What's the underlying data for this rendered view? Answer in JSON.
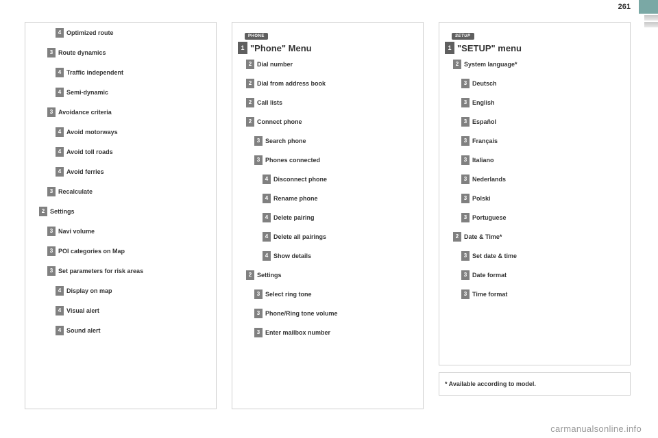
{
  "page_number": "261",
  "footer_url": "carmanualsonline.info",
  "footnote": "* Available according to model.",
  "col1": {
    "items": [
      {
        "n": "4",
        "label": "Optimized route",
        "indent": 3
      },
      {
        "n": "3",
        "label": "Route dynamics",
        "indent": 2
      },
      {
        "n": "4",
        "label": "Traffic independent",
        "indent": 3
      },
      {
        "n": "4",
        "label": "Semi-dynamic",
        "indent": 3
      },
      {
        "n": "3",
        "label": "Avoidance criteria",
        "indent": 2
      },
      {
        "n": "4",
        "label": "Avoid motorways",
        "indent": 3
      },
      {
        "n": "4",
        "label": "Avoid toll roads",
        "indent": 3
      },
      {
        "n": "4",
        "label": "Avoid ferries",
        "indent": 3
      },
      {
        "n": "3",
        "label": "Recalculate",
        "indent": 2
      },
      {
        "n": "2",
        "label": "Settings",
        "indent": 1
      },
      {
        "n": "3",
        "label": "Navi volume",
        "indent": 2
      },
      {
        "n": "3",
        "label": "POI categories on Map",
        "indent": 2
      },
      {
        "n": "3",
        "label": "Set parameters for risk areas",
        "indent": 2
      },
      {
        "n": "4",
        "label": "Display on map",
        "indent": 3
      },
      {
        "n": "4",
        "label": "Visual alert",
        "indent": 3
      },
      {
        "n": "4",
        "label": "Sound alert",
        "indent": 3
      }
    ]
  },
  "col2": {
    "chip": "PHONE",
    "title_num": "1",
    "title": "\"Phone\" Menu",
    "items": [
      {
        "n": "2",
        "label": "Dial number",
        "indent": 1
      },
      {
        "n": "2",
        "label": "Dial from address book",
        "indent": 1
      },
      {
        "n": "2",
        "label": "Call lists",
        "indent": 1
      },
      {
        "n": "2",
        "label": "Connect phone",
        "indent": 1
      },
      {
        "n": "3",
        "label": "Search phone",
        "indent": 2
      },
      {
        "n": "3",
        "label": "Phones connected",
        "indent": 2
      },
      {
        "n": "4",
        "label": "Disconnect phone",
        "indent": 3
      },
      {
        "n": "4",
        "label": "Rename phone",
        "indent": 3
      },
      {
        "n": "4",
        "label": "Delete pairing",
        "indent": 3
      },
      {
        "n": "4",
        "label": "Delete all pairings",
        "indent": 3
      },
      {
        "n": "4",
        "label": "Show details",
        "indent": 3
      },
      {
        "n": "2",
        "label": "Settings",
        "indent": 1
      },
      {
        "n": "3",
        "label": "Select ring tone",
        "indent": 2
      },
      {
        "n": "3",
        "label": "Phone/Ring tone volume",
        "indent": 2
      },
      {
        "n": "3",
        "label": "Enter mailbox number",
        "indent": 2
      }
    ]
  },
  "col3": {
    "chip": "SETUP",
    "title_num": "1",
    "title": "\"SETUP\" menu",
    "items": [
      {
        "n": "2",
        "label": "System language*",
        "indent": 1
      },
      {
        "n": "3",
        "label": "Deutsch",
        "indent": 2
      },
      {
        "n": "3",
        "label": "English",
        "indent": 2
      },
      {
        "n": "3",
        "label": "Español",
        "indent": 2
      },
      {
        "n": "3",
        "label": "Français",
        "indent": 2
      },
      {
        "n": "3",
        "label": "Italiano",
        "indent": 2
      },
      {
        "n": "3",
        "label": "Nederlands",
        "indent": 2
      },
      {
        "n": "3",
        "label": "Polski",
        "indent": 2
      },
      {
        "n": "3",
        "label": "Portuguese",
        "indent": 2
      },
      {
        "n": "2",
        "label": "Date & Time*",
        "indent": 1
      },
      {
        "n": "3",
        "label": "Set date & time",
        "indent": 2
      },
      {
        "n": "3",
        "label": "Date format",
        "indent": 2
      },
      {
        "n": "3",
        "label": "Time format",
        "indent": 2
      }
    ]
  }
}
